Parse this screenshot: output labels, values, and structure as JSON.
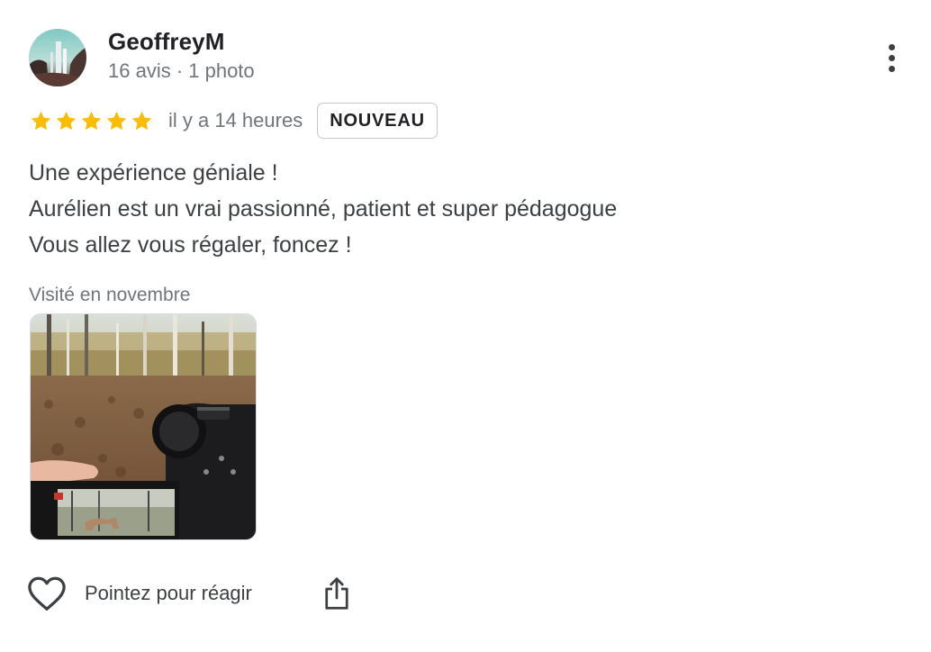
{
  "review": {
    "author": {
      "name": "GeoffreyM",
      "meta": "16 avis · 1 photo",
      "avatar_icon": "avatar-image"
    },
    "rating": {
      "stars": 5,
      "max": 5,
      "star_color": "#fbbc04"
    },
    "time": "il y a 14 heures",
    "badge": "NOUVEAU",
    "text_lines": [
      "Une expérience géniale !",
      "Aurélien est un vrai passionné, patient et super pédagogue",
      "Vous allez vous régaler, foncez !"
    ],
    "visited": "Visité en novembre",
    "photo_icon": "review-photo"
  },
  "actions": {
    "react_label": "Pointez pour réagir",
    "react_icon": "heart-icon",
    "share_icon": "share-icon",
    "more_icon": "more-vert-icon"
  }
}
